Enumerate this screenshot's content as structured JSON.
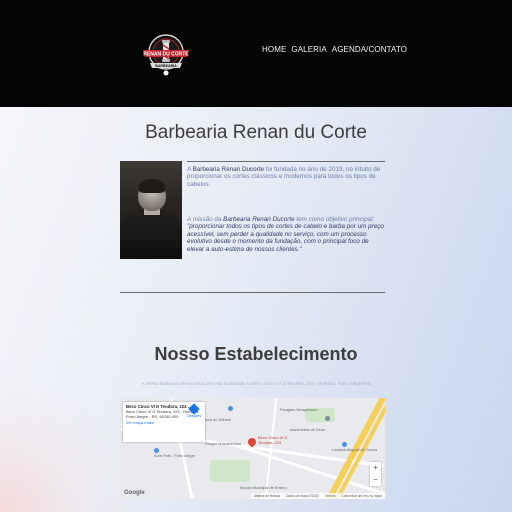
{
  "nav": {
    "items": [
      "HOME",
      "GALERIA",
      "AGENDA/CONTATO"
    ]
  },
  "logo": {
    "text_top": "RENAN DU CORTE",
    "text_bottom": "BARBEARIA"
  },
  "about": {
    "title": "Barbearia Renan du Corte",
    "p1_pre": "A ",
    "p1_name": "Barbearia Renan Ducorte",
    "p1_post": " foi fundada no ano de 2019, no intuito de proporcionar os cortes clássicos e modernos para todos os tipos de cabelos.",
    "p2_pre": "A missão da ",
    "p2_name": "Barbearia Renan Ducorte",
    "p2_mid": " tem como objetivo principal: ",
    "p2_quote": "\"proporcionar todos os tipos de cortes de cabelo e barba por um preço acessível, sem perder a qualidade no serviço, com um processo evolutivo desde o momento da fundação, com o principal foco de elevar a auto-estima de nossos clientes.\""
  },
  "establishment": {
    "title": "Nosso Estabelecimento",
    "address_line": "A Nossa Barbearia Renan DuCorte está localizada no Beco Cinco VI D Teodora, 224 - Humaitá, Porto Alegre/RS"
  },
  "map": {
    "info_title": "Beco Cinco VI D Teodora, 224 ...",
    "info_address": "Beco Cinco VI D Teodora, 224 - Humaitá, Porto Alegre - RS, 90240-000",
    "info_link": "Ver mapa maior",
    "directions_label": "Direções",
    "pin_label_line1": "Beco Cinco VI D",
    "pin_label_line2": "Teodora, 224",
    "pois": [
      "Paragem Neugebauer",
      "Arena do Grêmio",
      "Parque Mascarenhas",
      "Sure Park - Porto Alegre",
      "Assembleia de Deus",
      "Escola Municipal de Ensino",
      "Localiza Aluguel de Carros"
    ],
    "zoom_in": "+",
    "zoom_out": "−",
    "footer_items": [
      "Atalhos do teclado",
      "Dados do mapa ©2023",
      "Termos",
      "Comunicar um erro no mapa"
    ],
    "google_label": "Google"
  },
  "colors": {
    "topbar": "#050505",
    "accent_text": "#6d7fa6",
    "heading": "#3d3d3d"
  }
}
